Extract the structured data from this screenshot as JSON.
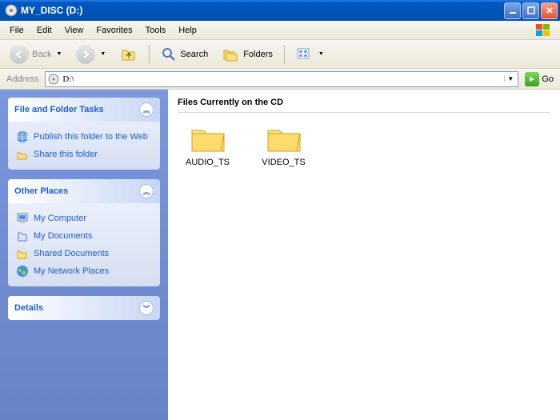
{
  "window": {
    "title": "MY_DISC (D:)"
  },
  "menu": [
    "File",
    "Edit",
    "View",
    "Favorites",
    "Tools",
    "Help"
  ],
  "toolbar": {
    "back": "Back",
    "search": "Search",
    "folders": "Folders"
  },
  "address": {
    "label": "Address",
    "value": "D:\\",
    "go": "Go"
  },
  "sidebar": {
    "tasks": {
      "title": "File and Folder Tasks",
      "items": [
        {
          "label": "Publish this folder to the Web",
          "icon": "globe"
        },
        {
          "label": "Share this folder",
          "icon": "share"
        }
      ]
    },
    "places": {
      "title": "Other Places",
      "items": [
        {
          "label": "My Computer",
          "icon": "computer"
        },
        {
          "label": "My Documents",
          "icon": "docs"
        },
        {
          "label": "Shared Documents",
          "icon": "shared"
        },
        {
          "label": "My Network Places",
          "icon": "network"
        }
      ]
    },
    "details": {
      "title": "Details"
    }
  },
  "main": {
    "section": "Files Currently on the CD",
    "folders": [
      {
        "name": "AUDIO_TS"
      },
      {
        "name": "VIDEO_TS"
      }
    ]
  }
}
